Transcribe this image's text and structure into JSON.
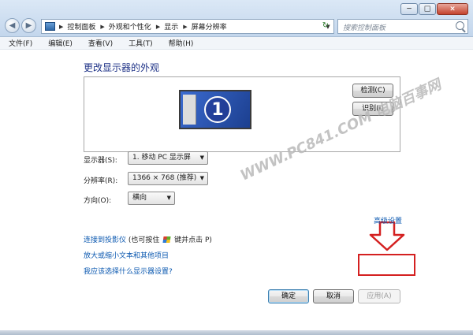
{
  "window": {
    "address_crumbs": [
      "控制面板",
      "外观和个性化",
      "显示",
      "屏幕分辨率"
    ],
    "search_placeholder": "搜索控制面板",
    "caption": {
      "minimize": "−",
      "maximize": "□",
      "close": "×"
    },
    "nav": {
      "back": "◀",
      "forward": "▶",
      "refresh": "↻"
    }
  },
  "menu": [
    {
      "label": "文件(F)"
    },
    {
      "label": "编辑(E)"
    },
    {
      "label": "查看(V)"
    },
    {
      "label": "工具(T)"
    },
    {
      "label": "帮助(H)"
    }
  ],
  "page": {
    "title": "更改显示器的外观",
    "monitor_number": "1",
    "detect_button": "检测(C)",
    "identify_button": "识别(I)",
    "display_label": "显示器(S):",
    "display_value": "1. 移动 PC 显示屏",
    "resolution_label": "分辨率(R):",
    "resolution_value": "1366 × 768 (推荐)",
    "orientation_label": "方向(O):",
    "orientation_value": "横向",
    "advanced_link": "高级设置",
    "link_projector_pre": "连接到投影仪",
    "link_projector_post": " (也可按住",
    "link_projector_tail": "键并点击 P)",
    "link_text_size": "放大或缩小文本和其他项目",
    "link_which_settings": "我应该选择什么显示器设置?",
    "ok_button": "确定",
    "cancel_button": "取消",
    "apply_button": "应用(A)",
    "watermark": "WWW.PC841.COM 电脑百事网"
  },
  "colors": {
    "title": "#1e3287",
    "link": "#0b58b0",
    "callout": "#d42020",
    "monitor": "#2b55b8"
  }
}
